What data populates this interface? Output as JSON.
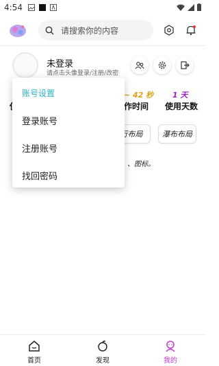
{
  "status_bar": {
    "time": "4:54"
  },
  "search": {
    "placeholder": "请搜索你的内容"
  },
  "profile": {
    "name": "未登录",
    "hint": "请点击头像登录/注册/改密"
  },
  "stats": [
    {
      "value": "42 秒",
      "label": "操作时间",
      "value_prefix": "~",
      "color": "#e0a21a",
      "visible_label": "作时间"
    },
    {
      "value": "1 天",
      "label": "使用天数",
      "color": "#9c1fbf"
    }
  ],
  "stat_left_partial_label": "使",
  "layouts": {
    "list": "平行布局",
    "waterfall": "瀑布布局"
  },
  "layout_list_visible": "行布局",
  "desc_visible": "、图标。",
  "menu": {
    "title": "账号设置",
    "items": [
      "登录账号",
      "注册账号",
      "找回密码"
    ]
  },
  "bottom_nav": [
    {
      "label": "首页",
      "icon": "home-icon",
      "active": false
    },
    {
      "label": "发现",
      "icon": "discover-icon",
      "active": false
    },
    {
      "label": "我的",
      "icon": "profile-icon",
      "active": true
    }
  ],
  "colors": {
    "accent": "#c23cc9",
    "menu_title": "#2bb3c2"
  }
}
